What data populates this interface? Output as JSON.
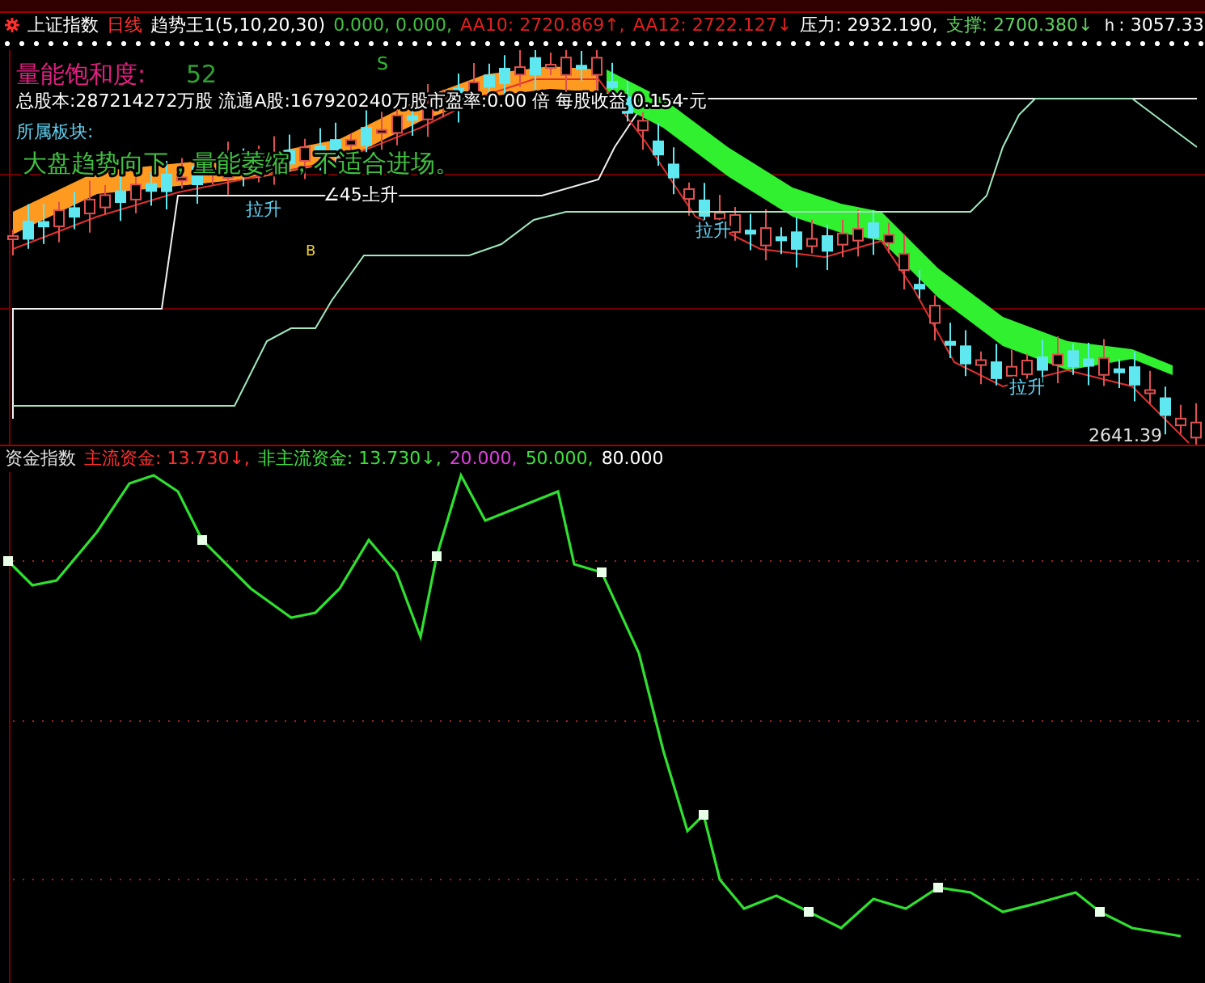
{
  "title_bar": [
    {
      "text": "上证指数",
      "color": "#ffffff"
    },
    {
      "text": "日线",
      "color": "#ff3030"
    },
    {
      "text": "趋势王1(5,10,20,30)",
      "color": "#ffffff"
    },
    {
      "text": "0.000, 0.000,",
      "color": "#40c040"
    },
    {
      "text": "AA10: 2720.869↑,",
      "color": "#e02020"
    },
    {
      "text": "AA12: 2722.127↓",
      "color": "#e02020"
    },
    {
      "text": "压力: 2932.190,",
      "color": "#ffffff"
    },
    {
      "text": "支撑: 2700.380↓",
      "color": "#60d060"
    },
    {
      "text": "ｈ: 3057.33",
      "color": "#ffffff"
    }
  ],
  "main_chart": {
    "saturation_label": "量能饱和度:",
    "saturation_value": "52",
    "signal": "S",
    "stock_info": "总股本:287214272万股 流通A股:167920240万股市盈率:0.00 倍 每股收益 0.154 元",
    "sector_label": "所属板块:",
    "advice": "大盘趋势向下，量能萎缩，不适合进场。",
    "angle_label": "∠45上升",
    "pull_labels": [
      "拉升",
      "拉升",
      "拉升"
    ],
    "buy_mark": "B",
    "last_price": "2641.39"
  },
  "fund_panel": {
    "title": "资金指数",
    "legend": [
      {
        "text": "主流资金: 13.730↓,",
        "color": "#ff3030"
      },
      {
        "text": "非主流资金: 13.730↓,",
        "color": "#40e040"
      },
      {
        "text": "20.000,",
        "color": "#e040e0"
      },
      {
        "text": "50.000,",
        "color": "#40e040"
      },
      {
        "text": "80.000",
        "color": "#ffffff"
      }
    ]
  }
}
